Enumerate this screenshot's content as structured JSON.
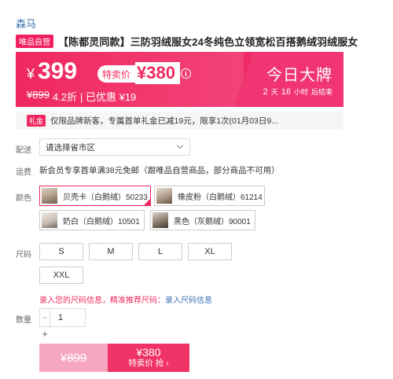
{
  "brand": {
    "name": "森马"
  },
  "title": {
    "badge": "唯品自营",
    "text": "【陈都灵同款】三防羽绒服女24冬纯色立领宽松百搭鹅绒羽绒服女"
  },
  "price": {
    "currency": "¥",
    "current": "399",
    "special_label": "特卖价",
    "special_price": "¥380",
    "info_icon": "i",
    "original": "¥899",
    "discount": "4.2折",
    "saved": "| 已优惠 ¥19",
    "promo_title": "今日大牌",
    "countdown": {
      "days": "2",
      "days_unit": "天",
      "hours": "16",
      "hours_unit": "小时",
      "suffix": "后结束"
    }
  },
  "coupon": {
    "badge": "礼金",
    "text": "仅限品牌新客，专属首单礼金已减19元，限享1次(01月03日9..."
  },
  "delivery": {
    "label": "配送",
    "placeholder": "请选择省市区"
  },
  "shipping": {
    "label": "运费",
    "text": "新会员专享首单满38元免邮（跟唯品自营商品，部分商品不可用）"
  },
  "colors": {
    "label": "颜色",
    "options": [
      {
        "label": "贝壳卡（白鹅绒）50233",
        "selected": true
      },
      {
        "label": "橡皮粉（白鹅绒）61214",
        "selected": false
      },
      {
        "label": "奶白（白鹅绒）10501",
        "selected": false
      },
      {
        "label": "黑色（灰鹅绒）90001",
        "selected": false
      }
    ]
  },
  "sizes": {
    "label": "尺码",
    "options": [
      "S",
      "M",
      "L",
      "XL",
      "XXL"
    ]
  },
  "size_hint": {
    "text": "录入您的尺码信息，精准推荐尺码：",
    "link": "录入尺码信息"
  },
  "quantity": {
    "label": "数量",
    "minus": "−",
    "value": "1",
    "plus": "+"
  },
  "buttons": {
    "original_price": "¥899",
    "buy_price": "¥380",
    "buy_label": "特卖价 抢 ›"
  },
  "colors_theme": {
    "accent": "#f0285f",
    "link": "#3a6fb0"
  }
}
